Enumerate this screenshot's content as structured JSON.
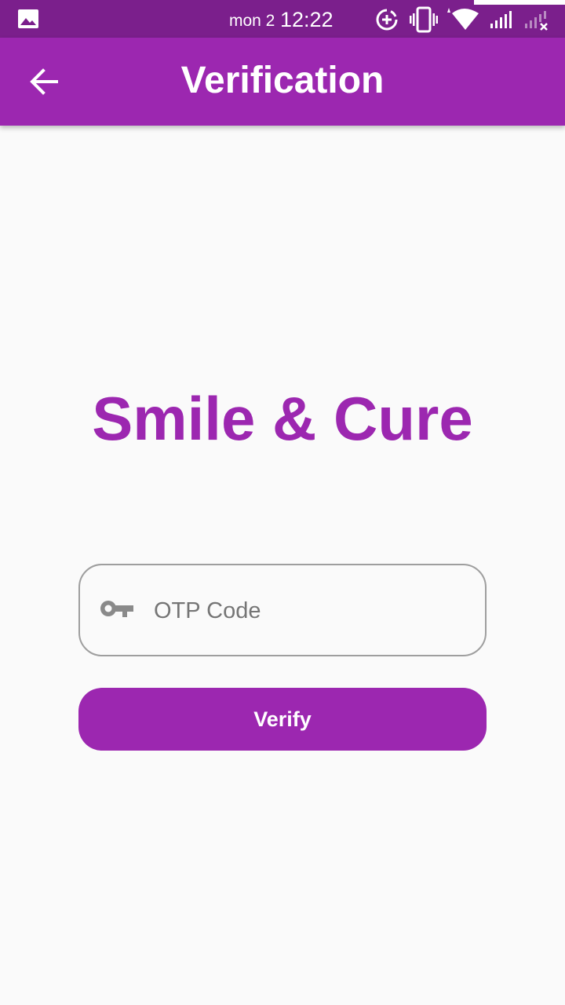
{
  "status_bar": {
    "date": "mon 2",
    "time": "12:22",
    "icons": [
      "gallery-icon",
      "data-saver-icon",
      "vibrate-icon",
      "wifi-icon",
      "signal-icon",
      "no-signal-icon"
    ]
  },
  "app_bar": {
    "title": "Verification",
    "back_icon": "arrow-back-icon"
  },
  "brand": {
    "name": "Smile & Cure"
  },
  "otp": {
    "placeholder": "OTP Code",
    "value": "",
    "icon": "key-icon"
  },
  "verify_button": {
    "label": "Verify"
  },
  "colors": {
    "primary": "#9c27b0",
    "status_bar": "#7b1f8c",
    "background": "#fafafa",
    "border": "#9e9e9e"
  }
}
